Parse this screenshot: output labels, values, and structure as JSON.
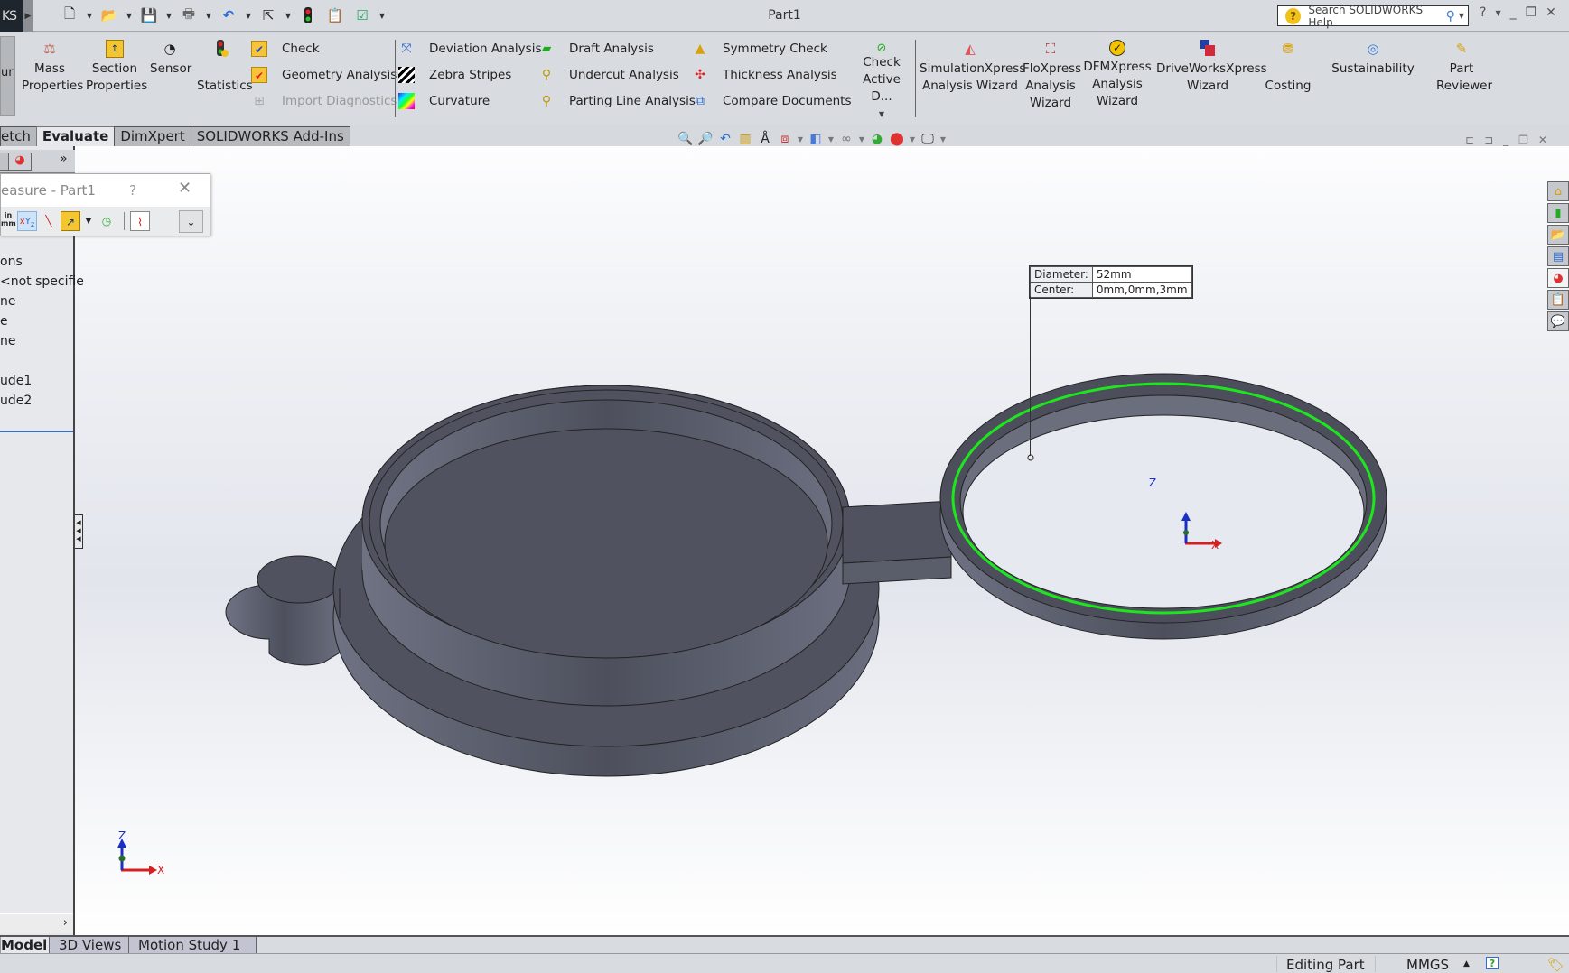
{
  "titlebar": {
    "logo_text": "KS",
    "document_title": "Part1",
    "search_placeholder": "Search SOLIDWORKS Help",
    "quick_access": [
      "new-document-icon",
      "open-icon",
      "save-icon",
      "print-icon",
      "undo-icon",
      "select-icon",
      "rebuild-icon",
      "file-properties-icon",
      "options-icon"
    ]
  },
  "ribbon": {
    "left_cut_label": "ure",
    "large_buttons": [
      {
        "id": "mass-properties",
        "line1": "Mass",
        "line2": "Properties",
        "line3": "",
        "icon": "scale-icon"
      },
      {
        "id": "section-properties",
        "line1": "Section",
        "line2": "Properties",
        "line3": "",
        "icon": "section-icon"
      },
      {
        "id": "sensor",
        "line1": "Sensor",
        "line2": "",
        "line3": "",
        "icon": "gauge-icon"
      },
      {
        "id": "statistics",
        "line1": "",
        "line2": "Statistics",
        "line3": "",
        "icon": "traffic-light-clock-icon"
      }
    ],
    "small_col1": [
      {
        "label": "Check",
        "icon": "check-icon",
        "disabled": false
      },
      {
        "label": "Geometry Analysis",
        "icon": "geometry-check-icon",
        "disabled": false
      },
      {
        "label": "Import Diagnostics",
        "icon": "import-diagnostics-icon",
        "disabled": true
      }
    ],
    "small_col2": [
      {
        "label": "Deviation Analysis",
        "icon": "deviation-icon"
      },
      {
        "label": "Zebra Stripes",
        "icon": "zebra-icon"
      },
      {
        "label": "Curvature",
        "icon": "curvature-icon"
      }
    ],
    "small_col3": [
      {
        "label": "Draft Analysis",
        "icon": "draft-icon"
      },
      {
        "label": "Undercut Analysis",
        "icon": "undercut-icon"
      },
      {
        "label": "Parting Line Analysis",
        "icon": "parting-line-icon"
      }
    ],
    "small_col4": [
      {
        "label": "Symmetry Check",
        "icon": "symmetry-icon"
      },
      {
        "label": "Thickness Analysis",
        "icon": "thickness-icon"
      },
      {
        "label": "Compare Documents",
        "icon": "compare-icon"
      }
    ],
    "check_active": {
      "line1": "Check",
      "line2": "Active D..."
    },
    "addins": [
      {
        "id": "simulationxpress",
        "line1": "SimulationXpress",
        "line2": "Analysis Wizard",
        "line3": ""
      },
      {
        "id": "floxpress",
        "line1": "FloXpress",
        "line2": "Analysis",
        "line3": "Wizard"
      },
      {
        "id": "dfmxpress",
        "line1": "DFMXpress",
        "line2": "Analysis",
        "line3": "Wizard"
      },
      {
        "id": "driveworksxpress",
        "line1": "DriveWorksXpress",
        "line2": "Wizard",
        "line3": ""
      },
      {
        "id": "costing",
        "line1": "",
        "line2": "Costing",
        "line3": ""
      },
      {
        "id": "sustainability",
        "line1": "Sustainability",
        "line2": "",
        "line3": ""
      },
      {
        "id": "part-reviewer",
        "line1": "Part",
        "line2": "Reviewer",
        "line3": ""
      }
    ]
  },
  "command_tabs": [
    {
      "label": "etch",
      "active": false
    },
    {
      "label": "Evaluate",
      "active": true
    },
    {
      "label": "DimXpert",
      "active": false
    },
    {
      "label": "SOLIDWORKS Add-Ins",
      "active": false
    }
  ],
  "measure": {
    "title": "easure - Part1",
    "help": "?",
    "units_top": "in",
    "units_bottom": "mm",
    "result": {
      "diameter_label": "Diameter:",
      "diameter_value": "52mm",
      "center_label": "Center:",
      "center_value": "0mm,0mm,3mm"
    }
  },
  "feature_tree": {
    "items": [
      "ons",
      "<not specifie",
      "ne",
      "e",
      "ne",
      "",
      "ude1",
      "ude2"
    ]
  },
  "triad": {
    "z": "Z",
    "x": "X"
  },
  "bottom_tabs": [
    {
      "label": "Model",
      "active": true
    },
    {
      "label": "3D Views",
      "active": false
    },
    {
      "label": "Motion Study 1",
      "active": false
    }
  ],
  "status": {
    "mode": "Editing Part",
    "units": "MMGS"
  },
  "colors": {
    "selection_edge": "#1ee61e",
    "model_body": "#50535f",
    "triad_x": "#d42020",
    "triad_z": "#1c2fc4"
  }
}
